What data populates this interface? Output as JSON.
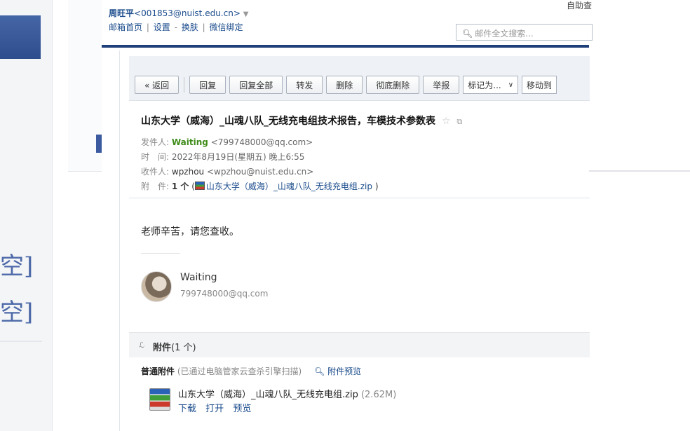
{
  "header": {
    "user_name": "周旺平",
    "user_email": "<001853@nuist.edu.cn>",
    "user_caret": "▼",
    "nav": [
      "邮箱首页",
      "设置",
      "换肤",
      "微信绑定"
    ],
    "help": "自助查",
    "search_placeholder": "邮件全文搜索..."
  },
  "toolbar": {
    "back": "« 返回",
    "reply": "回复",
    "reply_all": "回复全部",
    "forward": "转发",
    "delete": "删除",
    "perm_delete": "彻底删除",
    "report": "举报",
    "mark_as": "标记为...",
    "move_to": "移动到"
  },
  "email": {
    "subject": "山东大学（威海）_山魂八队_无线充电组技术报告，车模技术参数表",
    "from_label": "发件人:",
    "from_name": "Waiting",
    "from_addr": "<799748000@qq.com>",
    "time_label": "时　间:",
    "time_value": "2022年8月19日(星期五) 晚上6:55",
    "to_label": "收件人:",
    "to_name": "wpzhou",
    "to_addr": "<wpzhou@nuist.edu.cn>",
    "attach_label": "附　件:",
    "attach_count": "1 个",
    "attach_name": "山东大学（威海）_山魂八队_无线充电组.zip",
    "body": "老师辛苦，请您查收。",
    "sig_name": "Waiting",
    "sig_email": "799748000@qq.com"
  },
  "attachments": {
    "title": "附件",
    "count": "(1 个)",
    "section": "普通附件",
    "scan_note": "(已通过电脑管家云查杀引擎扫描)",
    "preview_link": "附件预览",
    "file_name": "山东大学（威海）_山魂八队_无线充电组.zip",
    "file_size": "(2.62M)",
    "actions": [
      "下载",
      "打开",
      "预览"
    ]
  },
  "background": {
    "text_a": "[空]",
    "text_b": "空]"
  },
  "colors": {
    "accent": "#1f3f7a",
    "link": "#1a4b8c",
    "sender": "#3f8c1a"
  },
  "icons": [
    "search-icon",
    "star-icon",
    "popout-icon",
    "zip-icon",
    "paperclip-icon",
    "magnifier-icon",
    "chevron-down-icon"
  ]
}
